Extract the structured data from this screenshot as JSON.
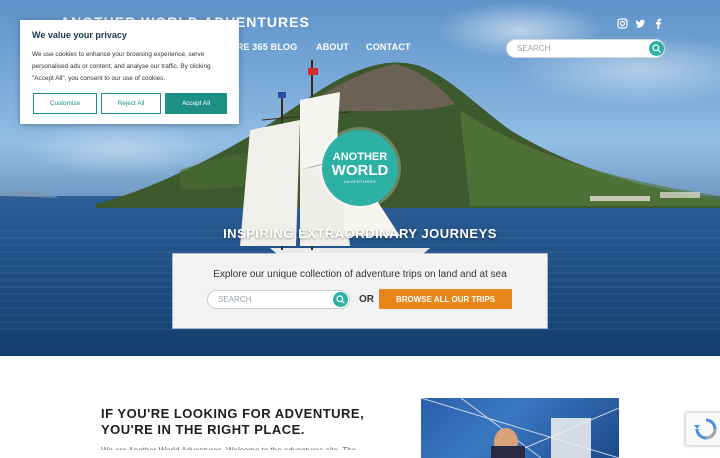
{
  "header": {
    "brand": "ANOTHER WORLD ADVENTURES",
    "nav": [
      "URE 365 BLOG",
      "ABOUT",
      "CONTACT"
    ],
    "social_icons": [
      "instagram-icon",
      "twitter-icon",
      "facebook-icon"
    ],
    "search_placeholder": "SEARCH"
  },
  "hero": {
    "logo": {
      "line1": "ANOTHER",
      "line2": "WORLD",
      "line3": "ADVENTURES"
    },
    "tagline": "INSPIRING EXTRAORDINARY JOURNEYS",
    "explore_text": "Explore our unique collection of adventure trips on land and at sea",
    "search_placeholder": "SEARCH",
    "or_label": "OR",
    "browse_label": "BROWSE ALL OUR TRIPS"
  },
  "intro": {
    "headline_line1": "IF YOU'RE LOOKING FOR ADVENTURE,",
    "headline_line2": "YOU'RE IN THE RIGHT PLACE.",
    "body_fragment": "We are Another World Adventures. Welcome to the adventures site. The"
  },
  "cookie_banner": {
    "title": "We value your privacy",
    "text": "We use cookies to enhance your browsing experience, serve personalised ads or content, and analyse our traffic. By clicking \"Accept All\", you consent to our use of cookies.",
    "customize": "Customize",
    "reject": "Reject All",
    "accept": "Accept All"
  },
  "colors": {
    "teal": "#2db1a4",
    "orange": "#e8861a",
    "cookie_green": "#1e8f85"
  }
}
